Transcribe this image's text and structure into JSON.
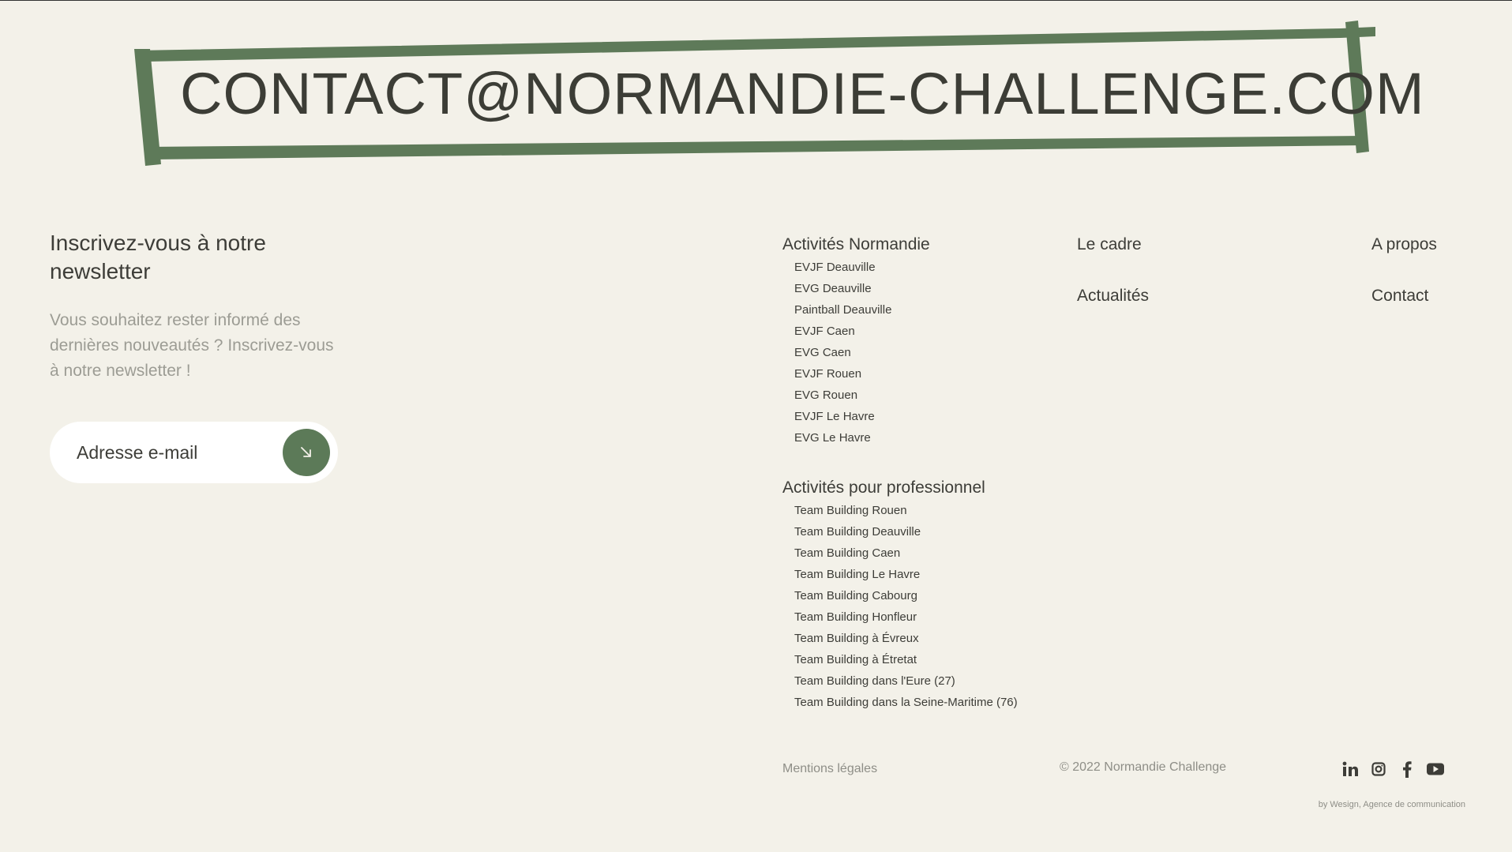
{
  "banner": {
    "email": "CONTACT@NORMANDIE-CHALLENGE.COM"
  },
  "newsletter": {
    "title": "Inscrivez-vous à notre newsletter",
    "description": "Vous souhaitez rester informé des dernières nouveautés ? Inscrivez-vous à notre newsletter !",
    "placeholder": "Adresse e-mail",
    "submit_icon": "arrow-down-right-icon"
  },
  "activites_normandie": {
    "title": "Activités Normandie",
    "items": [
      "EVJF Deauville",
      "EVG Deauville",
      "Paintball Deauville",
      "EVJF Caen",
      "EVG Caen",
      "EVJF Rouen",
      "EVG Rouen",
      "EVJF Le Havre",
      "EVG Le Havre"
    ]
  },
  "activites_pro": {
    "title": "Activités pour professionnel",
    "items": [
      "Team Building Rouen",
      "Team Building Deauville",
      "Team Building Caen",
      "Team Building Le Havre",
      "Team Building Cabourg",
      "Team Building Honfleur",
      "Team Building à Évreux",
      "Team Building à Étretat",
      "Team Building dans l'Eure (27)",
      "Team Building dans la Seine-Maritime (76)"
    ]
  },
  "nav": {
    "le_cadre": "Le cadre",
    "actualites": "Actualités",
    "a_propos": "A propos",
    "contact": "Contact"
  },
  "footer": {
    "legal": "Mentions légales",
    "copyright": "© 2022 Normandie Challenge",
    "credit": "by Wesign, Agence de communication",
    "socials": [
      "linkedin-icon",
      "instagram-icon",
      "facebook-icon",
      "youtube-icon"
    ]
  },
  "colors": {
    "background": "#f3f1e9",
    "accent_green": "#5c7a58",
    "text_dark": "#3d3d38",
    "text_muted": "#9c9c94"
  }
}
